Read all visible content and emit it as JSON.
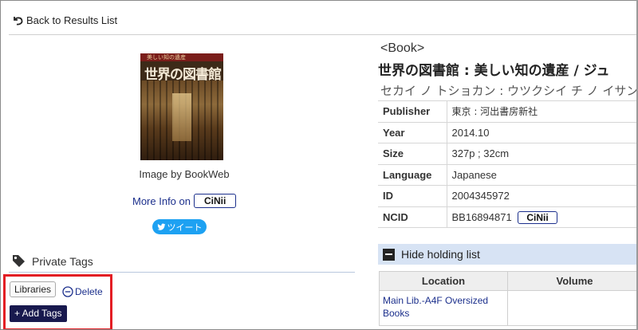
{
  "nav": {
    "back_label": "Back to Results List"
  },
  "cover": {
    "image_credit": "Image by BookWeb",
    "more_info_label": "More Info on",
    "cinii_label": "CiNii",
    "tweet_label": "ツイート",
    "cover_title_text": "世界の図書館",
    "cover_band_text": "美しい知の遺産"
  },
  "private_tags": {
    "heading": "Private Tags",
    "tags": [
      {
        "label": "Libraries",
        "delete_label": "Delete"
      }
    ],
    "add_label": "+ Add Tags"
  },
  "book": {
    "type_label": "<Book>",
    "title": "世界の図書館 : 美しい知の遺産 / ジュ",
    "reading": "セカイ ノ トショカン : ウツクシイ チ ノ イサン",
    "details": [
      {
        "key": "Publisher",
        "value": "東京 : 河出書房新社"
      },
      {
        "key": "Year",
        "value": "2014.10"
      },
      {
        "key": "Size",
        "value": "327p ; 32cm"
      },
      {
        "key": "Language",
        "value": "Japanese"
      },
      {
        "key": "ID",
        "value": "2004345972"
      },
      {
        "key": "NCID",
        "value": "BB16894871",
        "link_label": "CiNii"
      }
    ]
  },
  "holdings": {
    "toggle_label": "Hide holding list",
    "columns": [
      "Location",
      "Volume"
    ],
    "rows": [
      {
        "location": "Main Lib.-A4F Oversized Books",
        "volume": ""
      }
    ]
  },
  "colors": {
    "link": "#1b2f8c",
    "highlight_border": "#e31e24",
    "add_tags_button": "#18194e",
    "tweet_button": "#1da1f2",
    "holding_bar": "#d7e3f4"
  }
}
